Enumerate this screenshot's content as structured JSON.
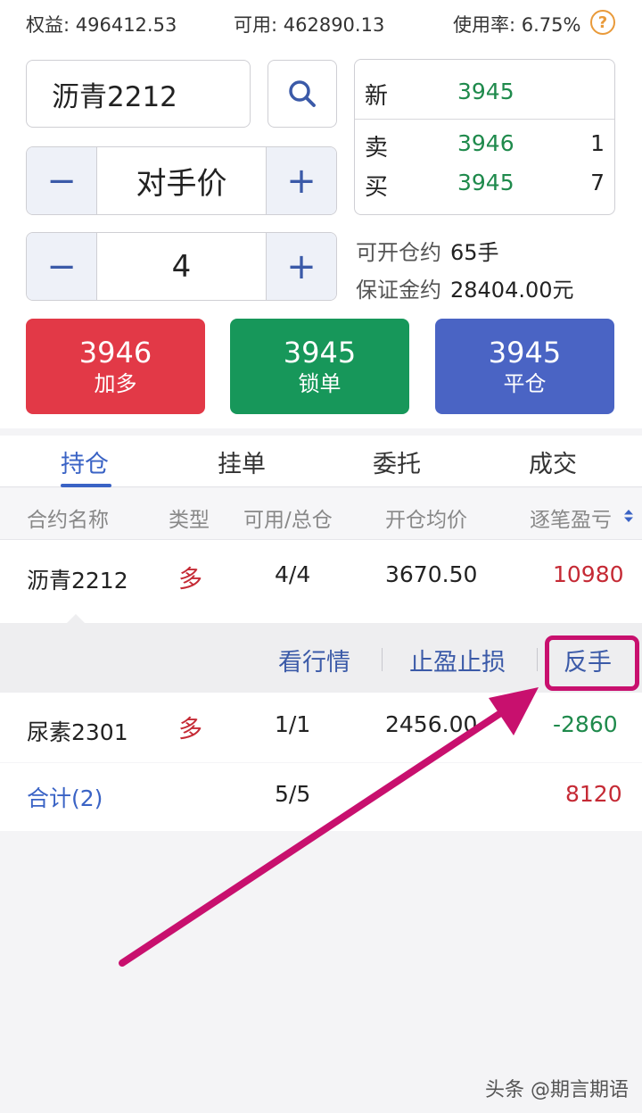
{
  "header": {
    "equity": "权益: 496412.53",
    "available": "可用: 462890.13",
    "usage": "使用率: 6.75%",
    "help_symbol": "?"
  },
  "order": {
    "symbol": "沥青2212",
    "price_type": "对手价",
    "quantity": "4",
    "minus": "−",
    "plus": "+"
  },
  "quote": {
    "last_label": "新",
    "last_price": "3945",
    "ask_label": "卖",
    "ask_price": "3946",
    "ask_volume": "1",
    "bid_label": "买",
    "bid_price": "3945",
    "bid_volume": "7"
  },
  "info": {
    "openable_label": "可开仓约",
    "openable_value": "65手",
    "margin_label": "保证金约",
    "margin_value": "28404.00元"
  },
  "actions": {
    "long_price": "3946",
    "long_label": "加多",
    "lock_price": "3945",
    "lock_label": "锁单",
    "close_price": "3945",
    "close_label": "平仓"
  },
  "tabs": [
    "持仓",
    "挂单",
    "委托",
    "成交"
  ],
  "columns": [
    "合约名称",
    "类型",
    "可用/总仓",
    "开仓均价",
    "逐笔盈亏"
  ],
  "positions": [
    {
      "name": "沥青2212",
      "type": "多",
      "qty": "4/4",
      "avg": "3670.50",
      "pnl": "10980"
    },
    {
      "name": "尿素2301",
      "type": "多",
      "qty": "1/1",
      "avg": "2456.00",
      "pnl": "-2860"
    }
  ],
  "row_actions": [
    "看行情",
    "止盈止损",
    "反手"
  ],
  "total": {
    "label": "合计(2)",
    "qty": "5/5",
    "pnl": "8120"
  },
  "colors": {
    "up": "#c52a35",
    "down": "#1f8a4c",
    "accent": "#3a63c5",
    "highlight": "#c8106e"
  },
  "watermark": "头条 @期言期语"
}
